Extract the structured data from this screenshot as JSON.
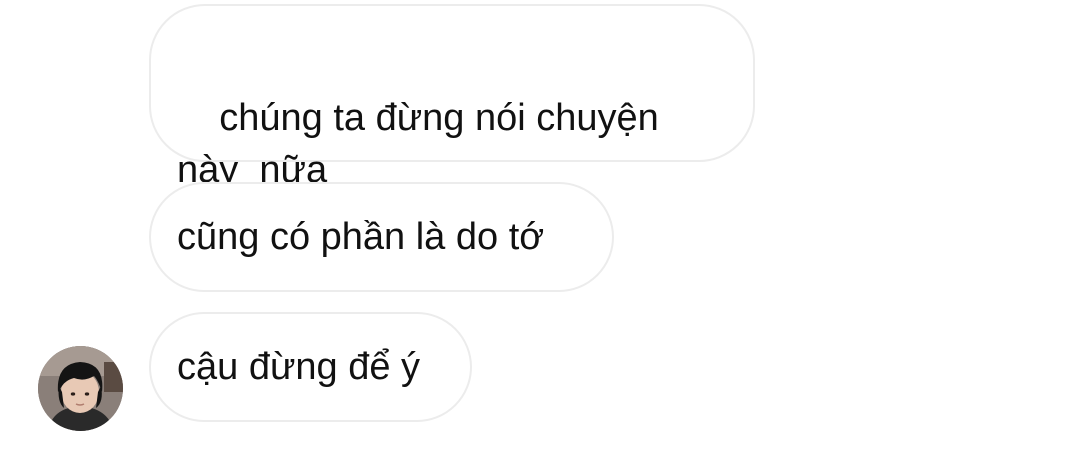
{
  "messages": [
    {
      "sender": "other",
      "text": "chúng ta đừng nói chuyện\nnày  nữa"
    },
    {
      "sender": "other",
      "text": "cũng có phần là do tớ"
    },
    {
      "sender": "other",
      "text": "cậu đừng để ý"
    }
  ],
  "avatar": {
    "icon": "contact-avatar-photo",
    "colors": {
      "hair": "#141414",
      "skin": "#e8c9b5",
      "background": "#8a7f79",
      "shirt": "#2a2a2a"
    }
  },
  "theme": {
    "bubble_border": "#ececec",
    "text": "#111111",
    "background": "#ffffff"
  }
}
